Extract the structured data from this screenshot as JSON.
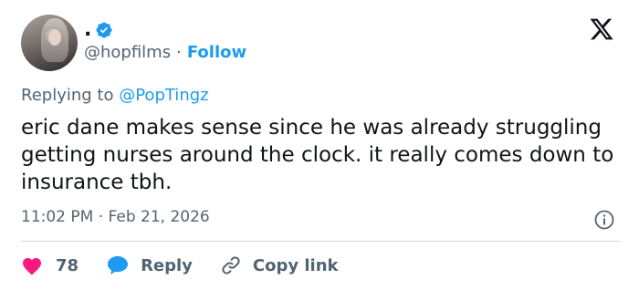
{
  "author": {
    "display_name": ".",
    "handle": "@hopfilms",
    "separator": "·",
    "follow_label": "Follow"
  },
  "reply_context": {
    "prefix": "Replying to",
    "mention": "@PopTingz"
  },
  "tweet": {
    "text": "eric dane makes sense since he was already struggling getting nurses around the clock. it really comes down to insurance tbh.",
    "time": "11:02 PM",
    "date_separator": "·",
    "date": "Feb 21, 2026"
  },
  "actions": {
    "like_count": "78",
    "reply_label": "Reply",
    "copy_label": "Copy link"
  },
  "colors": {
    "accent": "#1d9bf0",
    "like": "#f91880",
    "secondary_text": "#536471",
    "divider": "#cfd9de"
  },
  "icons": {
    "verified": "verified-badge-icon",
    "logo": "x-logo-icon",
    "info": "info-icon",
    "like": "heart-icon",
    "reply": "speech-bubble-icon",
    "copy": "link-icon"
  }
}
